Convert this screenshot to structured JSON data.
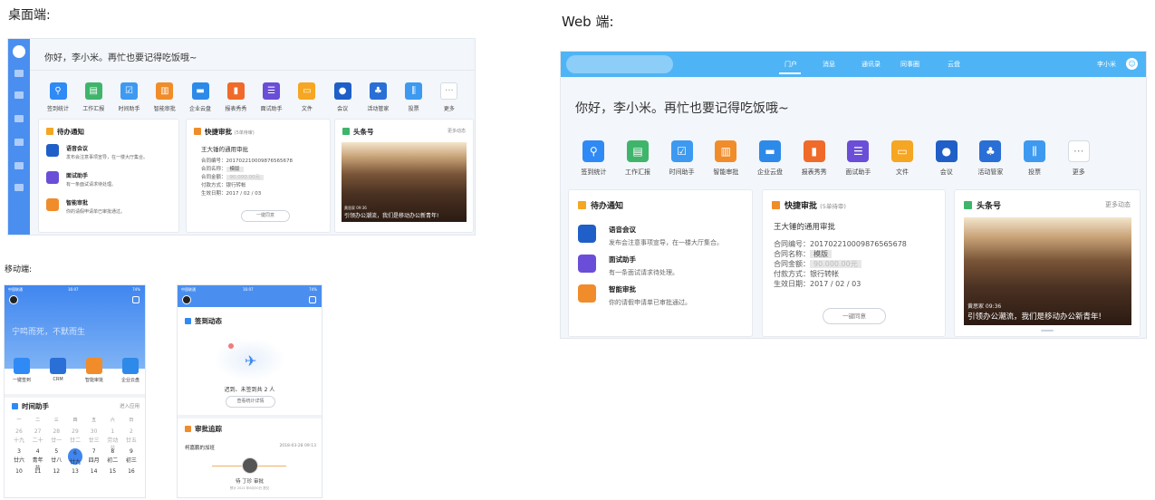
{
  "labels": {
    "desktop": "桌面端:",
    "web": "Web 端:",
    "mobile": "移动端:"
  },
  "greeting": "你好，李小米。再忙也要记得吃饭哦~",
  "apps": [
    {
      "label": "签到统计",
      "icon": "location-pin-icon",
      "color": "#2f8af5"
    },
    {
      "label": "工作汇报",
      "icon": "report-chart-icon",
      "color": "#3fb56b"
    },
    {
      "label": "时间助手",
      "icon": "calendar-check-icon",
      "color": "#3d9af0"
    },
    {
      "label": "智能审批",
      "icon": "approval-doc-icon",
      "color": "#f08c2a"
    },
    {
      "label": "企业云盘",
      "icon": "folder-icon",
      "color": "#2d8ae8"
    },
    {
      "label": "报表秀秀",
      "icon": "bar-chart-icon",
      "color": "#f06a2a"
    },
    {
      "label": "面试助手",
      "icon": "interview-icon",
      "color": "#6a4ed8"
    },
    {
      "label": "文件",
      "icon": "file-folder-icon",
      "color": "#f5a623"
    },
    {
      "label": "会议",
      "icon": "meeting-icon",
      "color": "#1f5fc7"
    },
    {
      "label": "活动管家",
      "icon": "people-icon",
      "color": "#2a6fd6"
    },
    {
      "label": "投票",
      "icon": "vote-bars-icon",
      "color": "#3d9af0"
    },
    {
      "label": "更多",
      "icon": "more-dots-icon",
      "color": "#ffffff"
    }
  ],
  "notifications": {
    "title": "待办通知",
    "items": [
      {
        "title": "语音会议",
        "subtitle": "发布会注意事项宣导，在一楼大厅集合。",
        "color": "#1f5fc7"
      },
      {
        "title": "面试助手",
        "subtitle": "有一条面试请求待处理。",
        "color": "#6a4ed8"
      },
      {
        "title": "智能审批",
        "subtitle": "你的请假申请单已审批通过。",
        "color": "#f08c2a"
      }
    ]
  },
  "approval": {
    "title": "快捷审批",
    "pending": "(5单待审)",
    "name": "王大锤的通用审批",
    "fields": [
      {
        "label": "合同编号：",
        "value": "20170221000987656567​8"
      },
      {
        "label": "合同名称：",
        "value": "模版"
      },
      {
        "label": "合同金额：",
        "value": "90.000.00元"
      },
      {
        "label": "付款方式：",
        "value": "银行转帐"
      },
      {
        "label": "生效日期：",
        "value": "2017 / 02 / 03"
      }
    ],
    "button": "一键同意"
  },
  "headline": {
    "title": "头条号",
    "more": "更多动态",
    "caption": "引领办公潮流，我们是移动办公新青年!",
    "byline": "黄思家 09:36"
  },
  "web_nav": {
    "items": [
      "门户",
      "消息",
      "通讯录",
      "同事圈",
      "云盘"
    ],
    "user": "李小米"
  },
  "mobile1": {
    "status_left": "中国联通",
    "status_time": "16:07",
    "status_right": "74%",
    "motto": "宁鸣而死，不默而生",
    "apps": [
      {
        "label": "一键签到",
        "color": "#2f8af5"
      },
      {
        "label": "CRM",
        "color": "#2a6fd6"
      },
      {
        "label": "智能审批",
        "color": "#f08c2a"
      },
      {
        "label": "企业云盘",
        "color": "#2d8ae8"
      }
    ],
    "time_title": "时间助手",
    "time_link": "进入应用",
    "weekdays": [
      "一",
      "二",
      "三",
      "四",
      "五",
      "六",
      "日"
    ],
    "weeks": [
      [
        {
          "d": "26",
          "s": "十九"
        },
        {
          "d": "27",
          "s": "二十"
        },
        {
          "d": "28",
          "s": "廿一"
        },
        {
          "d": "29",
          "s": "廿二"
        },
        {
          "d": "30",
          "s": "廿三"
        },
        {
          "d": "1",
          "s": "劳动节"
        },
        {
          "d": "2",
          "s": "廿五"
        }
      ],
      [
        {
          "d": "3",
          "s": "廿六"
        },
        {
          "d": "4",
          "s": "青年节"
        },
        {
          "d": "5",
          "s": "廿八"
        },
        {
          "d": "6",
          "s": "廿九"
        },
        {
          "d": "7",
          "s": "四月"
        },
        {
          "d": "8",
          "s": "初二"
        },
        {
          "d": "9",
          "s": "初三"
        }
      ],
      [
        {
          "d": "10",
          "s": ""
        },
        {
          "d": "11",
          "s": ""
        },
        {
          "d": "12",
          "s": ""
        },
        {
          "d": "13",
          "s": ""
        },
        {
          "d": "14",
          "s": ""
        },
        {
          "d": "15",
          "s": ""
        },
        {
          "d": "16",
          "s": ""
        }
      ]
    ]
  },
  "mobile2": {
    "status_left": "中国联通",
    "status_time": "16:07",
    "status_right": "74%",
    "checkin_title": "签到动态",
    "checkin_text": "迟到、未签到共 2 人",
    "checkin_button": "查看统计详情",
    "track_title": "审批追踪",
    "track_name": "柯嘉鹏的加班",
    "track_time": "2018-03-28 09:13",
    "track_status": "待 丁珍 审批",
    "track_note": "预计 2021 年6月30日 提交"
  }
}
